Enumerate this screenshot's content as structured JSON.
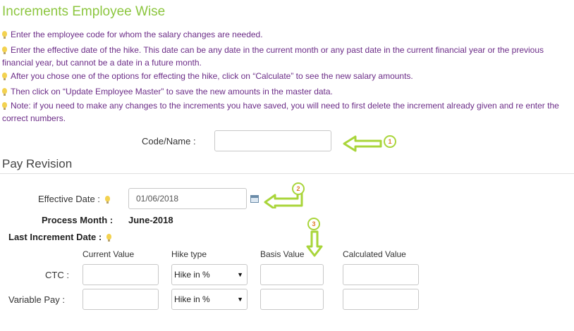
{
  "page": {
    "title": "Increments Employee Wise"
  },
  "tips": [
    "Enter the employee code for whom the salary changes are needed.",
    "Enter the effective date of the hike. This date can be any date in the current month or any past date in the current financial year or the previous financial year, but cannot be a date in a future month.",
    "After you chose one of the options for effecting the hike, click on “Calculate” to see the new salary amounts.",
    "Then click on “Update Employee Master” to save the new amounts in the master data.",
    "Note: if you need to make any changes to the increments you have saved, you will need to first delete the increment already given and re enter the correct numbers."
  ],
  "code_name": {
    "label": "Code/Name :",
    "value": ""
  },
  "pay_revision": {
    "heading": "Pay Revision",
    "effective_date_label": "Effective Date :",
    "effective_date_value": "01/06/2018",
    "process_month_label": "Process Month :",
    "process_month_value": "June-2018",
    "last_increment_label": "Last Increment Date :"
  },
  "table": {
    "headers": [
      "Current Value",
      "Hike type",
      "Basis Value",
      "Calculated Value"
    ],
    "rows": [
      {
        "label": "CTC :",
        "hike_type": "Hike in %"
      },
      {
        "label": "Variable Pay :",
        "hike_type": "Hike in %"
      }
    ]
  },
  "annotations": [
    "1",
    "2",
    "3"
  ],
  "icons": {
    "tip": "lightbulb-icon",
    "calendar": "calendar-icon",
    "arrow": "arrow-annotation-icon"
  },
  "colors": {
    "title": "#8cc63f",
    "tips": "#6b2c87",
    "annotation": "#a9d53a",
    "annotation_number": "#e07b2a"
  }
}
